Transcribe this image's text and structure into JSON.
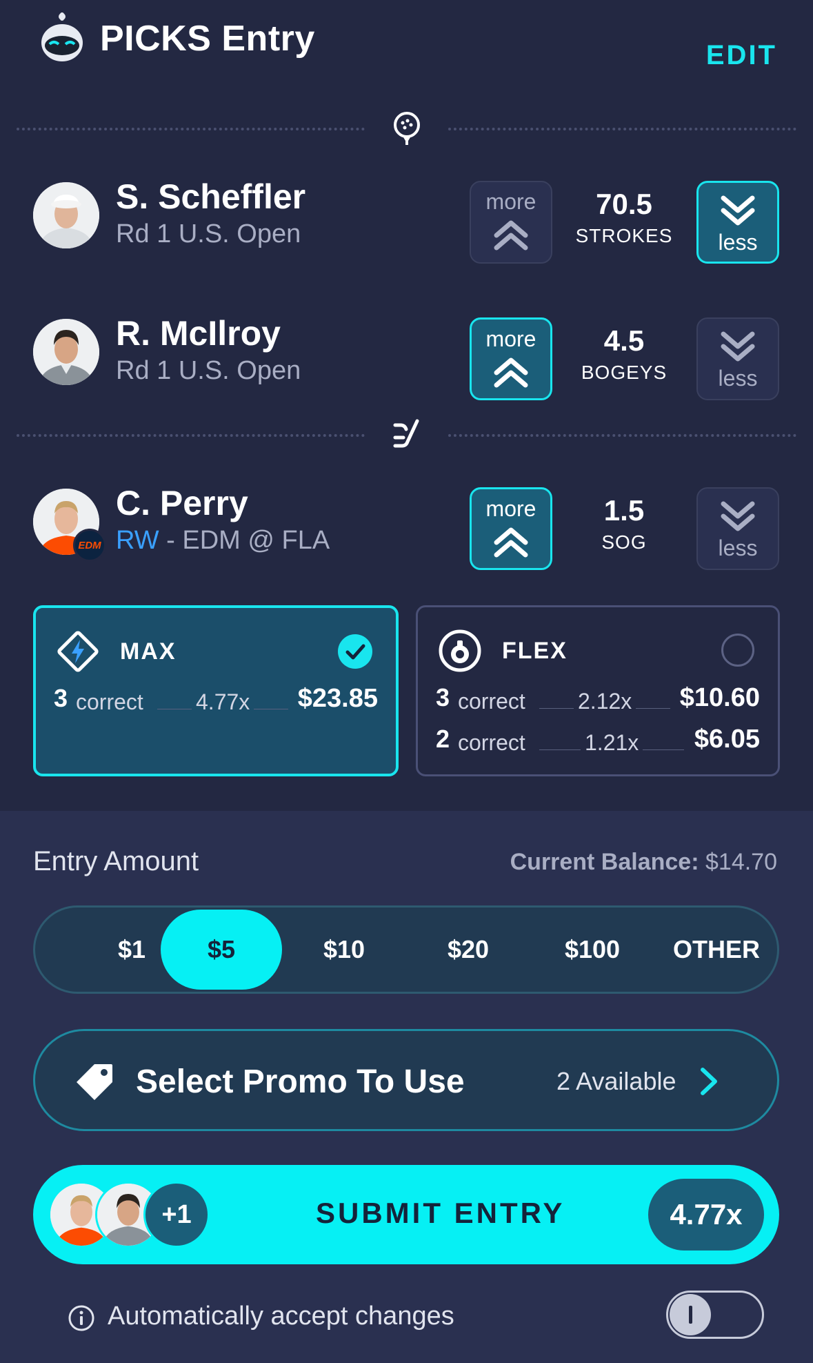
{
  "header": {
    "title": "PICKS Entry",
    "edit_label": "EDIT"
  },
  "sport_icons": {
    "golf": "golf-ball-icon",
    "hockey": "hockey-stick-icon"
  },
  "picks": [
    {
      "name": "S. Scheffler",
      "subtitle": "Rd 1 U.S. Open",
      "line": "70.5",
      "stat": "STROKES",
      "more_label": "more",
      "less_label": "less",
      "selected": "less"
    },
    {
      "name": "R. McIlroy",
      "subtitle": "Rd 1 U.S. Open",
      "line": "4.5",
      "stat": "BOGEYS",
      "more_label": "more",
      "less_label": "less",
      "selected": "more"
    },
    {
      "name": "C. Perry",
      "position": "RW",
      "subtitle": " - EDM @ FLA",
      "team_badge": "EDM",
      "line": "1.5",
      "stat": "SOG",
      "more_label": "more",
      "less_label": "less",
      "selected": "more"
    }
  ],
  "payouts": {
    "max": {
      "name": "MAX",
      "selected": true,
      "rows": [
        {
          "count": "3",
          "label": "correct",
          "mult": "4.77x",
          "amount": "$23.85"
        }
      ]
    },
    "flex": {
      "name": "FLEX",
      "selected": false,
      "rows": [
        {
          "count": "3",
          "label": "correct",
          "mult": "2.12x",
          "amount": "$10.60"
        },
        {
          "count": "2",
          "label": "correct",
          "mult": "1.21x",
          "amount": "$6.05"
        }
      ]
    }
  },
  "entry": {
    "label": "Entry Amount",
    "balance_label": "Current Balance:",
    "balance_value": "$14.70",
    "options": [
      "$1",
      "$5",
      "$10",
      "$20",
      "$100",
      "OTHER"
    ],
    "selected": "$5"
  },
  "promo": {
    "label": "Select Promo To Use",
    "available": "2 Available"
  },
  "submit": {
    "label": "SUBMIT ENTRY",
    "extra_count": "+1",
    "multiplier": "4.77x"
  },
  "auto_accept": {
    "label": "Automatically accept changes",
    "enabled": false
  },
  "colors": {
    "accent": "#19e5ee",
    "background": "#232842",
    "selected_fill": "#1b5e79",
    "cta": "#06f0f4"
  }
}
